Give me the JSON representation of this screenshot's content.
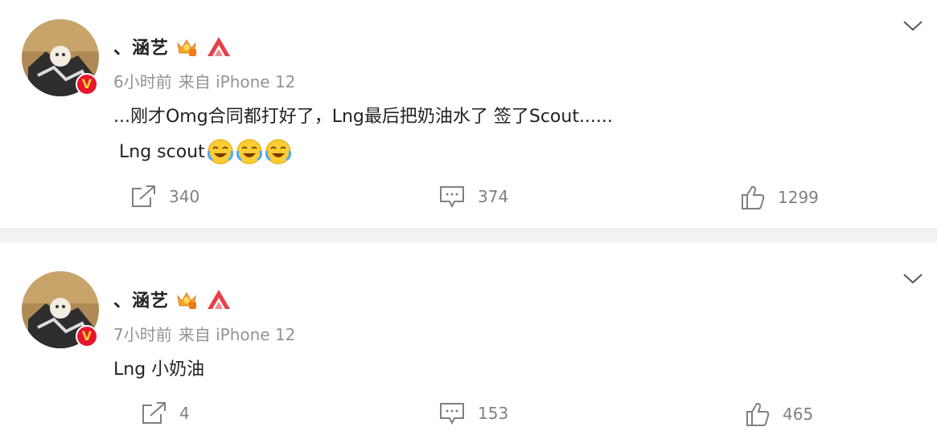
{
  "posts": [
    {
      "username": "、涵艺",
      "time": "6小时前",
      "source": "来自 iPhone 12",
      "text_line1": "...刚才Omg合同都打好了，Lng最后把奶油水了 签了Scout......",
      "text_line2": "Lng scout",
      "emojis": [
        "laughing-crying-emoji",
        "laughing-crying-emoji",
        "laughing-crying-emoji"
      ],
      "actions": {
        "share": "340",
        "comment": "374",
        "like": "1299"
      }
    },
    {
      "username": "、涵艺",
      "time": "7小时前",
      "source": "来自 iPhone 12",
      "text_line1": "Lng 小奶油",
      "actions": {
        "share": "4",
        "comment": "153",
        "like": "465"
      }
    }
  ],
  "badge_letter": "V",
  "colors": {
    "verified_badge": "#e6162d",
    "badge_letter": "#ffcc33",
    "meta_text": "#939393",
    "action_text": "#808080",
    "separator": "#f2f2f2"
  },
  "icons": [
    "crown-level-icon",
    "brand-mark-icon",
    "chevron-down-icon",
    "share-icon",
    "comment-icon",
    "like-icon"
  ]
}
